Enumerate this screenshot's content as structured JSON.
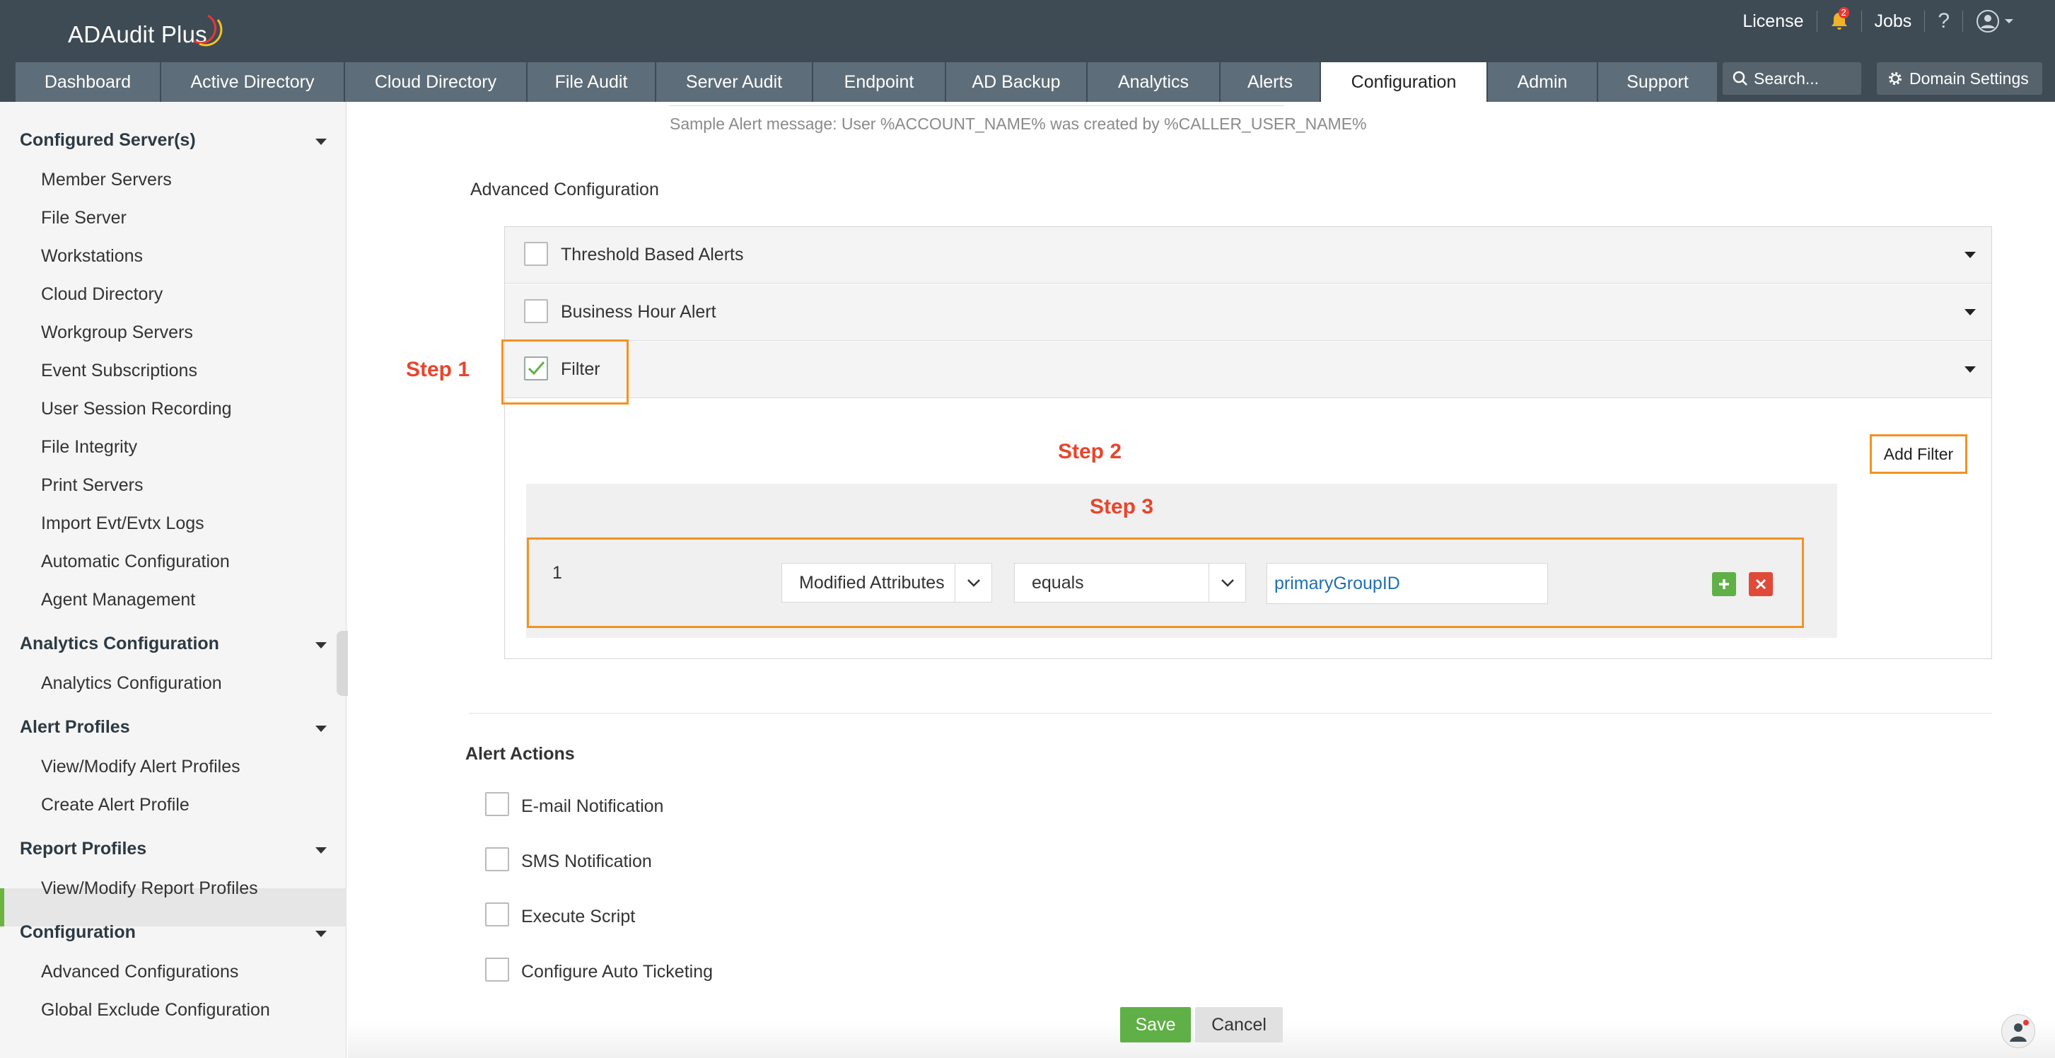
{
  "app": {
    "name": "ADAudit Plus"
  },
  "top_links": {
    "license": "License",
    "notif_count": "2",
    "jobs": "Jobs",
    "help": "?"
  },
  "tabs": [
    {
      "label": "Dashboard"
    },
    {
      "label": "Active Directory"
    },
    {
      "label": "Cloud Directory"
    },
    {
      "label": "File Audit"
    },
    {
      "label": "Server Audit"
    },
    {
      "label": "Endpoint"
    },
    {
      "label": "AD Backup"
    },
    {
      "label": "Analytics"
    },
    {
      "label": "Alerts"
    },
    {
      "label": "Configuration"
    },
    {
      "label": "Admin"
    },
    {
      "label": "Support"
    }
  ],
  "active_tab": "Configuration",
  "search": {
    "placeholder": "Search..."
  },
  "domain_settings": "Domain Settings",
  "sidebar": {
    "sections": [
      {
        "title": "Configured Server(s)",
        "items": [
          "Member Servers",
          "File Server",
          "Workstations",
          "Cloud Directory",
          "Workgroup Servers",
          "Event Subscriptions",
          "User Session Recording",
          "File Integrity",
          "Print Servers",
          "Import Evt/Evtx Logs",
          "Automatic Configuration",
          "Agent Management"
        ]
      },
      {
        "title": "Analytics Configuration",
        "items": [
          "Analytics Configuration"
        ]
      },
      {
        "title": "Alert Profiles",
        "items": [
          "View/Modify Alert Profiles",
          "Create Alert Profile"
        ]
      },
      {
        "title": "Report Profiles",
        "items": [
          "View/Modify Report Profiles"
        ]
      },
      {
        "title": "Configuration",
        "items": [
          "Advanced Configurations",
          "Global Exclude Configuration"
        ]
      }
    ],
    "active_item": "Create Alert Profile"
  },
  "main": {
    "sample_message": "Sample Alert message: User %ACCOUNT_NAME% was created by %CALLER_USER_NAME%",
    "advanced_title": "Advanced Configuration",
    "accordion": [
      {
        "label": "Threshold Based Alerts",
        "checked": false
      },
      {
        "label": "Business Hour Alert",
        "checked": false
      },
      {
        "label": "Filter",
        "checked": true
      }
    ],
    "steps": {
      "step1": "Step 1",
      "step2": "Step 2",
      "step3": "Step 3"
    },
    "add_filter": "Add Filter",
    "filter_row": {
      "index": "1",
      "attribute": "Modified Attributes",
      "operator": "equals",
      "value": "primaryGroupID"
    },
    "alert_actions_title": "Alert Actions",
    "actions": [
      {
        "label": "E-mail Notification"
      },
      {
        "label": "SMS Notification"
      },
      {
        "label": "Execute Script"
      },
      {
        "label": "Configure Auto Ticketing"
      }
    ],
    "save": "Save",
    "cancel": "Cancel"
  },
  "colors": {
    "header": "#3e4b55",
    "tab": "#5d6d79",
    "accent_orange": "#f39322",
    "step_red": "#e8452c",
    "save_green": "#5fb046",
    "active_bar": "#6cb33f"
  }
}
